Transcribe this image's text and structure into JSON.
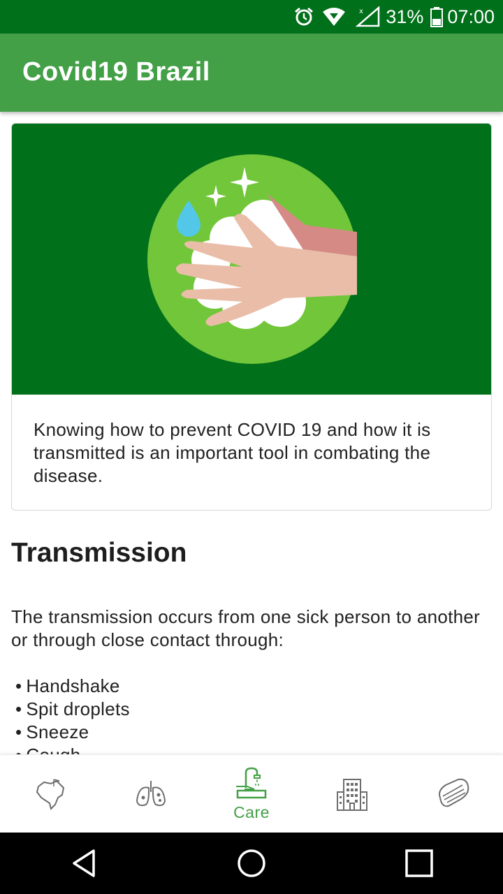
{
  "status_bar": {
    "battery": "31%",
    "time": "07:00",
    "icons": [
      "alarm-icon",
      "wifi-icon",
      "signal-icon",
      "battery-icon"
    ]
  },
  "app_bar": {
    "title": "Covid19 Brazil"
  },
  "info_card": {
    "illustration": "handwashing-illustration",
    "text": "Knowing how to prevent COVID 19 and how it is transmitted is an important tool in combating the disease."
  },
  "transmission": {
    "title": "Transmission",
    "intro": "The transmission occurs from one sick person to another or through close contact through:",
    "items": [
      "Handshake",
      "Spit droplets",
      "Sneeze",
      "Cough"
    ]
  },
  "bottom_nav": {
    "items": [
      {
        "icon": "brazil-map-icon",
        "label": ""
      },
      {
        "icon": "lungs-icon",
        "label": ""
      },
      {
        "icon": "handwash-icon",
        "label": "Care",
        "active": true
      },
      {
        "icon": "hospital-icon",
        "label": ""
      },
      {
        "icon": "face-mask-icon",
        "label": ""
      }
    ]
  },
  "colors": {
    "status_bar": "#00701a",
    "app_bar": "#43a047",
    "banner": "#00701a",
    "accent": "#43a047"
  }
}
